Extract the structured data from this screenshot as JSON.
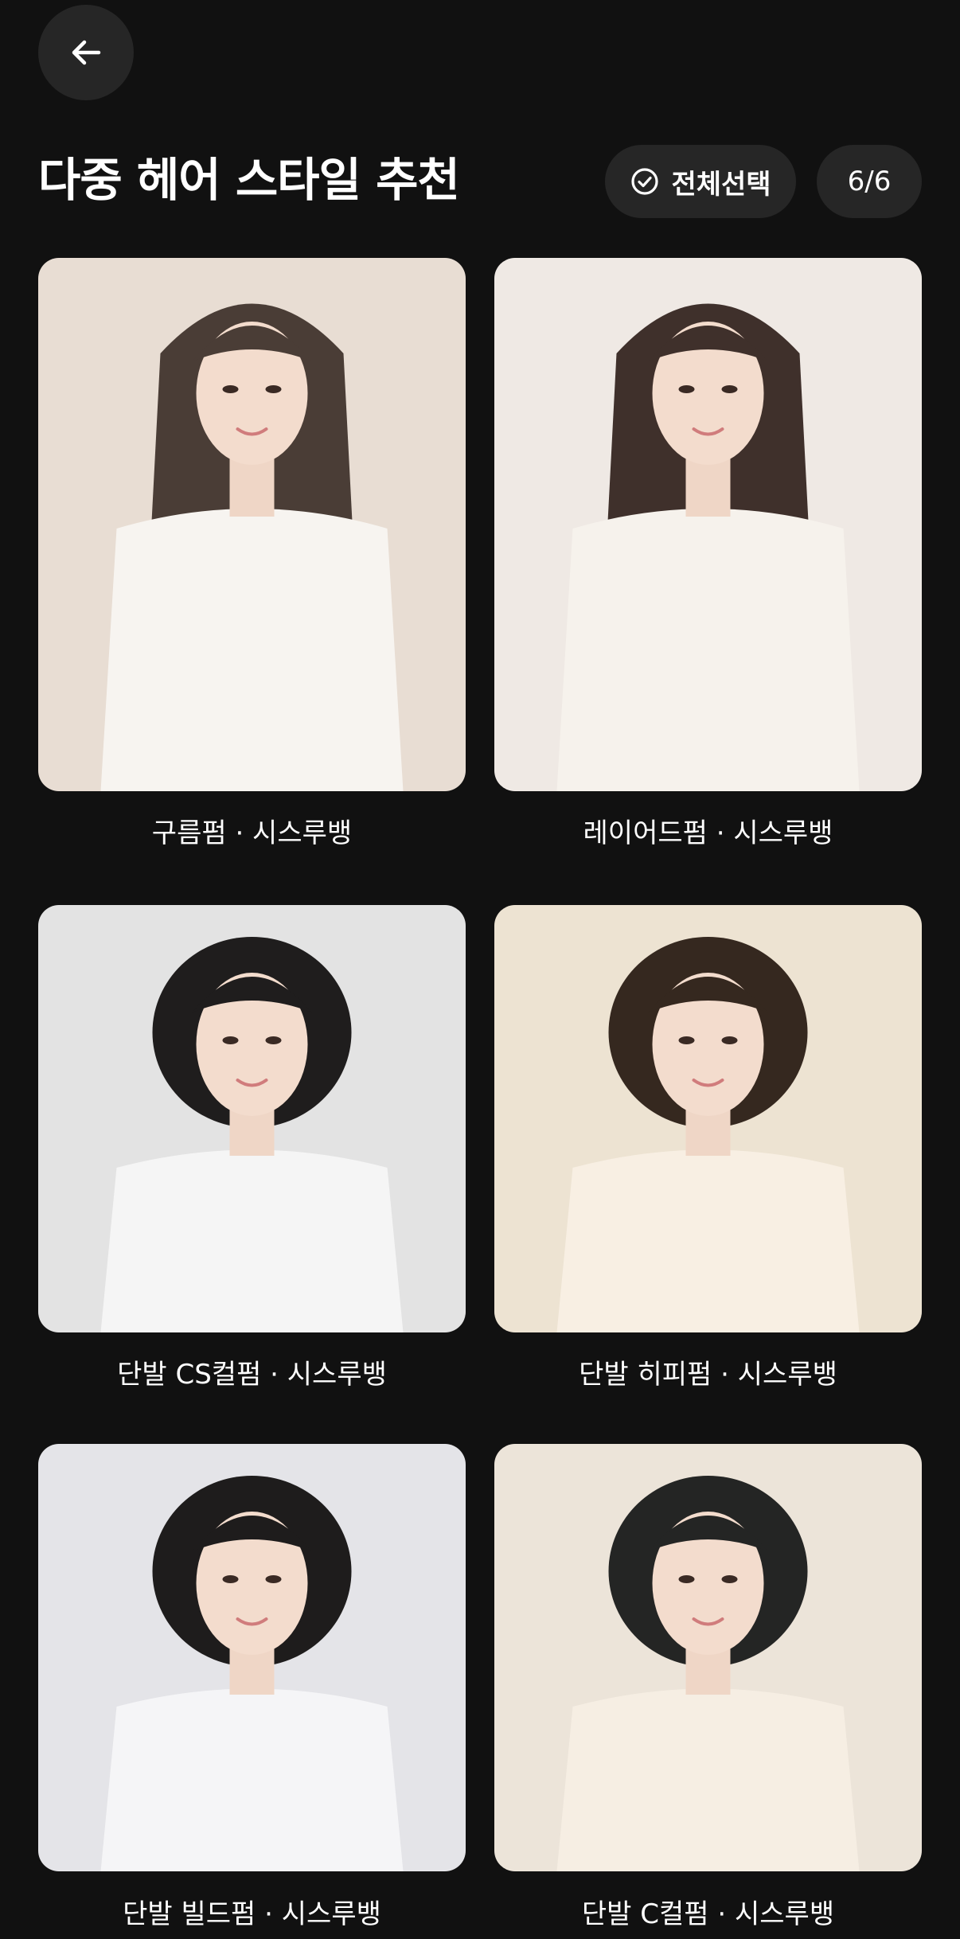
{
  "header": {
    "back_icon": "arrow-left-icon",
    "title": "다중 헤어 스타일 추천",
    "select_all": {
      "icon": "check-circle-icon",
      "label": "전체선택"
    },
    "count": "6/6"
  },
  "styles": [
    {
      "label": "구름펌 · 시스루뱅",
      "bg": "#e8ddd3",
      "hair": "#4a3d36",
      "top": "#f7f4f0"
    },
    {
      "label": "레이어드펌 · 시스루뱅",
      "bg": "#efe9e4",
      "hair": "#3f302b",
      "top": "#f6f2ec"
    },
    {
      "label": "단발 CS컬펌 · 시스루뱅",
      "bg": "#e3e3e3",
      "hair": "#1f1d1d",
      "top": "#f5f5f5"
    },
    {
      "label": "단발 히피펌 · 시스루뱅",
      "bg": "#ede3d2",
      "hair": "#35281f",
      "top": "#f8efe3"
    },
    {
      "label": "단발 빌드펌 · 시스루뱅",
      "bg": "#e4e4e8",
      "hair": "#1e1c1c",
      "top": "#f5f5f7"
    },
    {
      "label": "단발 C컬펌 · 시스루뱅",
      "bg": "#ece4d9",
      "hair": "#242524",
      "top": "#f6eee3"
    }
  ]
}
